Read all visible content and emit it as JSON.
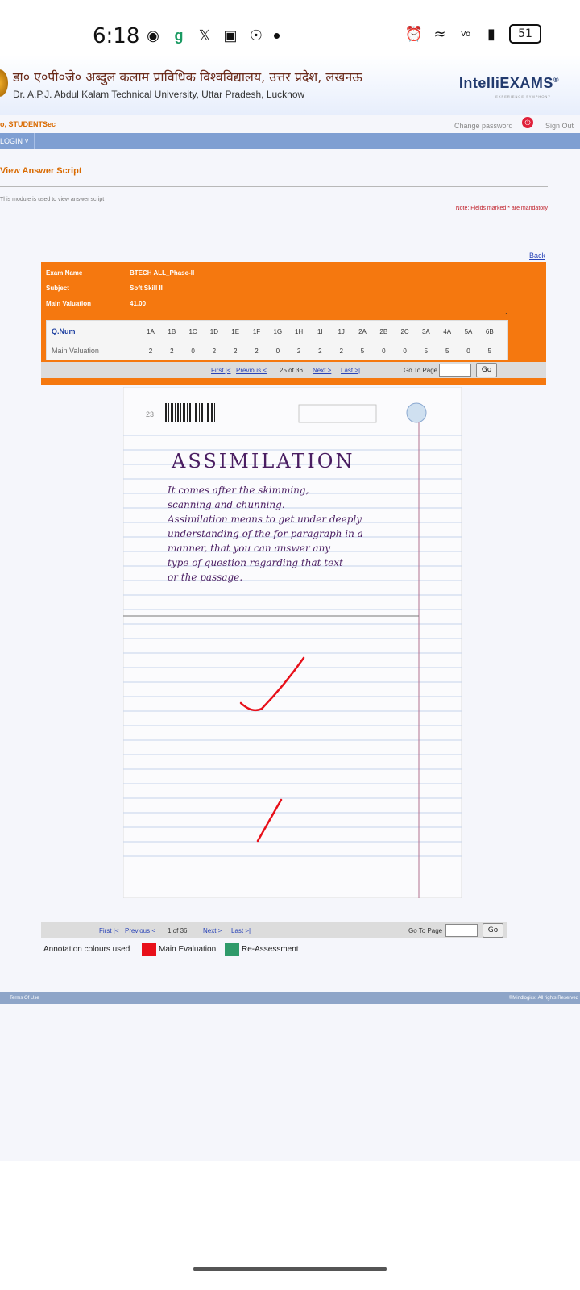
{
  "status_bar": {
    "time": "6:18",
    "battery": "51"
  },
  "header": {
    "university_hindi": "डा० ए०पी०जे० अब्दुल कलाम प्राविधिक विश्वविद्यालय, उत्तर प्रदेश, लखनऊ",
    "university_english": "Dr. A.P.J. Abdul Kalam Technical University, Uttar Pradesh, Lucknow",
    "brand": "IntelliEXAMS",
    "brand_tagline": "EXPERIENCE SYMPHONY"
  },
  "user_bar": {
    "username": "o, STUDENTSec",
    "change_password": "Change password",
    "sign_out": "Sign Out"
  },
  "nav": {
    "login_menu": "LOGIN ˅"
  },
  "page": {
    "title": "View Answer Script",
    "description": "This module is used to view answer script",
    "mandatory_note": "Note: Fields marked * are mandatory",
    "back": "Back"
  },
  "exam": {
    "labels": {
      "exam_name": "Exam Name",
      "subject": "Subject",
      "main_valuation": "Main Valuation"
    },
    "exam_name": "BTECH ALL_Phase-II",
    "subject": "Soft Skill II",
    "main_valuation": "41.00",
    "collapse_symbol": "⌃"
  },
  "marks_table": {
    "row_labels": {
      "qnum": "Q.Num",
      "valuation": "Main Valuation"
    },
    "questions": [
      "1A",
      "1B",
      "1C",
      "1D",
      "1E",
      "1F",
      "1G",
      "1H",
      "1I",
      "1J",
      "2A",
      "2B",
      "2C",
      "3A",
      "4A",
      "5A",
      "6B"
    ],
    "marks": [
      "2",
      "2",
      "0",
      "2",
      "2",
      "2",
      "0",
      "2",
      "2",
      "2",
      "5",
      "0",
      "0",
      "5",
      "5",
      "0",
      "5"
    ]
  },
  "pager_top": {
    "first": "First |<",
    "previous": "Previous <",
    "position": "25 of 36",
    "next": "Next >",
    "last": "Last >|",
    "goto_label": "Go To Page",
    "go": "Go"
  },
  "pager_bottom": {
    "first": "First |<",
    "previous": "Previous <",
    "position": "1 of 36",
    "next": "Next >",
    "last": "Last >|",
    "goto_label": "Go To Page",
    "go": "Go"
  },
  "answer_script": {
    "page_number": "23",
    "heading": "Assimilation",
    "lines": [
      "It comes after the skimming,",
      "scanning and chunning.",
      "Assimilation means to get under deeply",
      "understanding of the for paragraph in a",
      "manner, that you can answer any",
      "type of question regarding that text",
      "or the passage."
    ]
  },
  "legend": {
    "label": "Annotation colours used",
    "items": [
      {
        "name": "Main Evaluation",
        "color": "#e8101a"
      },
      {
        "name": "Re-Assessment",
        "color": "#2f9a6a"
      }
    ]
  },
  "footer": {
    "terms": "Terms Of Use",
    "copyright": "©Mindlogicx. All rights Reserved"
  },
  "colors": {
    "accent_orange": "#f5780f",
    "nav_blue": "#7f9fd2",
    "link_blue": "#2a44b8"
  }
}
